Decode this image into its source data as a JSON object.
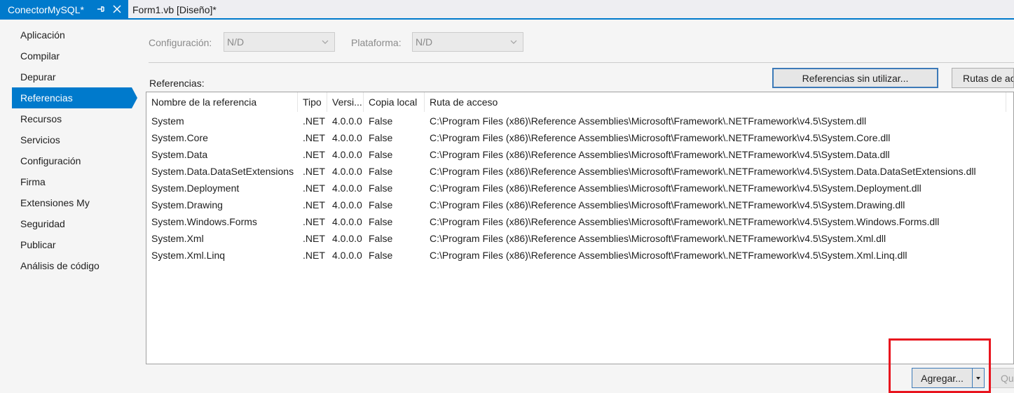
{
  "tabs": [
    {
      "label": "ConectorMySQL*",
      "active": true
    },
    {
      "label": "Form1.vb [Diseño]*",
      "active": false
    }
  ],
  "sidebar": {
    "items": [
      {
        "label": "Aplicación"
      },
      {
        "label": "Compilar"
      },
      {
        "label": "Depurar"
      },
      {
        "label": "Referencias",
        "selected": true
      },
      {
        "label": "Recursos"
      },
      {
        "label": "Servicios"
      },
      {
        "label": "Configuración"
      },
      {
        "label": "Firma"
      },
      {
        "label": "Extensiones My"
      },
      {
        "label": "Seguridad"
      },
      {
        "label": "Publicar"
      },
      {
        "label": "Análisis de código"
      }
    ]
  },
  "config": {
    "configuracion_label": "Configuración:",
    "configuracion_value": "N/D",
    "plataforma_label": "Plataforma:",
    "plataforma_value": "N/D"
  },
  "toolbar": {
    "unused_refs_label": "Referencias sin utilizar...",
    "ref_paths_label": "Rutas de ac"
  },
  "references": {
    "label": "Referencias:",
    "columns": [
      "Nombre de la referencia",
      "Tipo",
      "Versi...",
      "Copia local",
      "Ruta de acceso"
    ],
    "rows": [
      [
        "System",
        ".NET",
        "4.0.0.0",
        "False",
        "C:\\Program Files (x86)\\Reference Assemblies\\Microsoft\\Framework\\.NETFramework\\v4.5\\System.dll"
      ],
      [
        "System.Core",
        ".NET",
        "4.0.0.0",
        "False",
        "C:\\Program Files (x86)\\Reference Assemblies\\Microsoft\\Framework\\.NETFramework\\v4.5\\System.Core.dll"
      ],
      [
        "System.Data",
        ".NET",
        "4.0.0.0",
        "False",
        "C:\\Program Files (x86)\\Reference Assemblies\\Microsoft\\Framework\\.NETFramework\\v4.5\\System.Data.dll"
      ],
      [
        "System.Data.DataSetExtensions",
        ".NET",
        "4.0.0.0",
        "False",
        "C:\\Program Files (x86)\\Reference Assemblies\\Microsoft\\Framework\\.NETFramework\\v4.5\\System.Data.DataSetExtensions.dll"
      ],
      [
        "System.Deployment",
        ".NET",
        "4.0.0.0",
        "False",
        "C:\\Program Files (x86)\\Reference Assemblies\\Microsoft\\Framework\\.NETFramework\\v4.5\\System.Deployment.dll"
      ],
      [
        "System.Drawing",
        ".NET",
        "4.0.0.0",
        "False",
        "C:\\Program Files (x86)\\Reference Assemblies\\Microsoft\\Framework\\.NETFramework\\v4.5\\System.Drawing.dll"
      ],
      [
        "System.Windows.Forms",
        ".NET",
        "4.0.0.0",
        "False",
        "C:\\Program Files (x86)\\Reference Assemblies\\Microsoft\\Framework\\.NETFramework\\v4.5\\System.Windows.Forms.dll"
      ],
      [
        "System.Xml",
        ".NET",
        "4.0.0.0",
        "False",
        "C:\\Program Files (x86)\\Reference Assemblies\\Microsoft\\Framework\\.NETFramework\\v4.5\\System.Xml.dll"
      ],
      [
        "System.Xml.Linq",
        ".NET",
        "4.0.0.0",
        "False",
        "C:\\Program Files (x86)\\Reference Assemblies\\Microsoft\\Framework\\.NETFramework\\v4.5\\System.Xml.Linq.dll"
      ]
    ]
  },
  "actions": {
    "agregar_label": "Agregar...",
    "quitar_label": "Qu"
  },
  "icons": {
    "pin": "pin-icon",
    "close": "close-icon",
    "dropdown": "chevron-down-icon",
    "split_dropdown": "caret-down-icon"
  },
  "colors": {
    "accent": "#007acc",
    "highlight": "#e8141e"
  }
}
